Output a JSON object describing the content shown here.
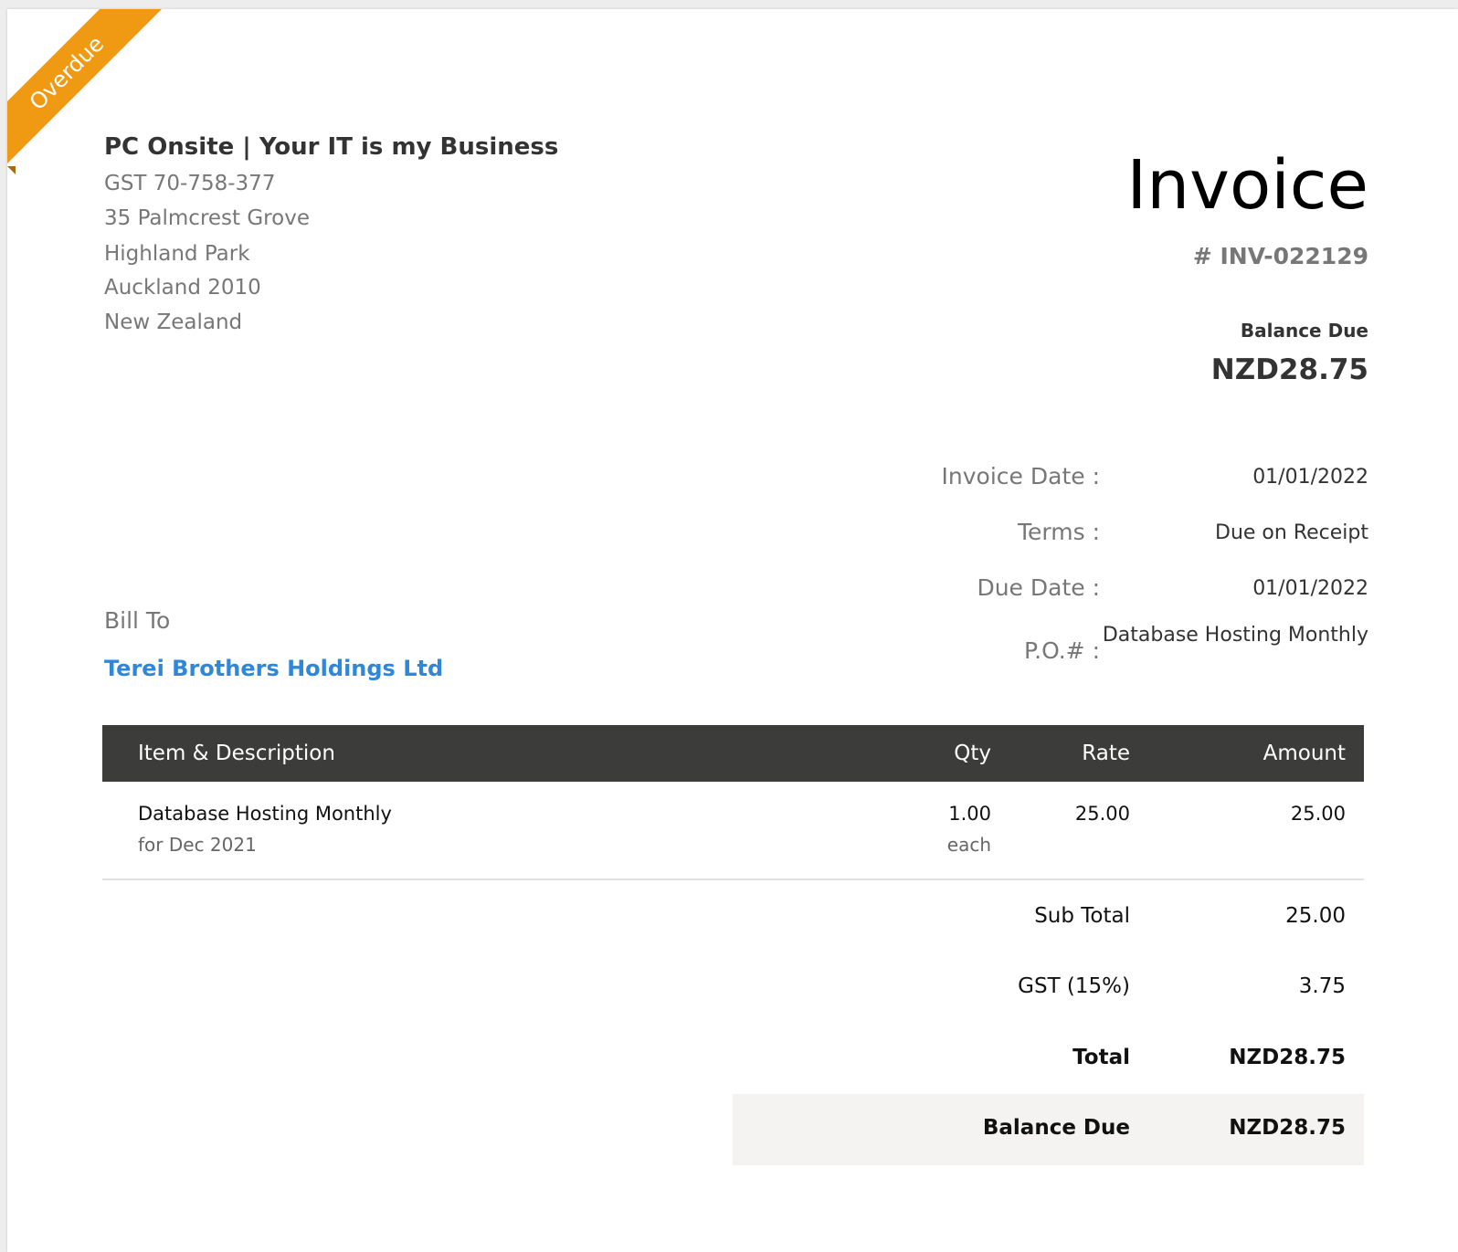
{
  "status_ribbon": "Overdue",
  "organization": {
    "name": "PC Onsite | Your IT is my Business",
    "gst": "GST 70-758-377",
    "address_line1": "35 Palmcrest Grove",
    "address_line2": "Highland Park",
    "address_line3": "Auckland  2010",
    "country": "New Zealand"
  },
  "invoice": {
    "title": "Invoice",
    "number": "# INV-022129",
    "balance_due_label": "Balance Due",
    "balance_due_amount": "NZD28.75"
  },
  "meta": {
    "invoice_date_label": "Invoice Date :",
    "invoice_date": "01/01/2022",
    "terms_label": "Terms :",
    "terms": "Due on Receipt",
    "due_date_label": "Due Date :",
    "due_date": "01/01/2022",
    "po_label": "P.O.# :",
    "po": "Database Hosting Monthly"
  },
  "bill_to": {
    "label": "Bill To",
    "customer": "Terei Brothers Holdings Ltd"
  },
  "table": {
    "headers": {
      "item": "Item & Description",
      "qty": "Qty",
      "rate": "Rate",
      "amount": "Amount"
    },
    "rows": [
      {
        "item": "Database Hosting Monthly",
        "description": "for Dec 2021",
        "qty": "1.00",
        "unit": "each",
        "rate": "25.00",
        "amount": "25.00"
      }
    ]
  },
  "totals": {
    "sub_total_label": "Sub Total",
    "sub_total": "25.00",
    "tax_label": "GST (15%)",
    "tax": "3.75",
    "total_label": "Total",
    "total": "NZD28.75",
    "balance_due_label": "Balance Due",
    "balance_due": "NZD28.75"
  },
  "colors": {
    "ribbon": "#f09a14",
    "table_header": "#3c3c3a",
    "customer_link": "#2f87d9",
    "balance_row_bg": "#f4f3f1"
  }
}
